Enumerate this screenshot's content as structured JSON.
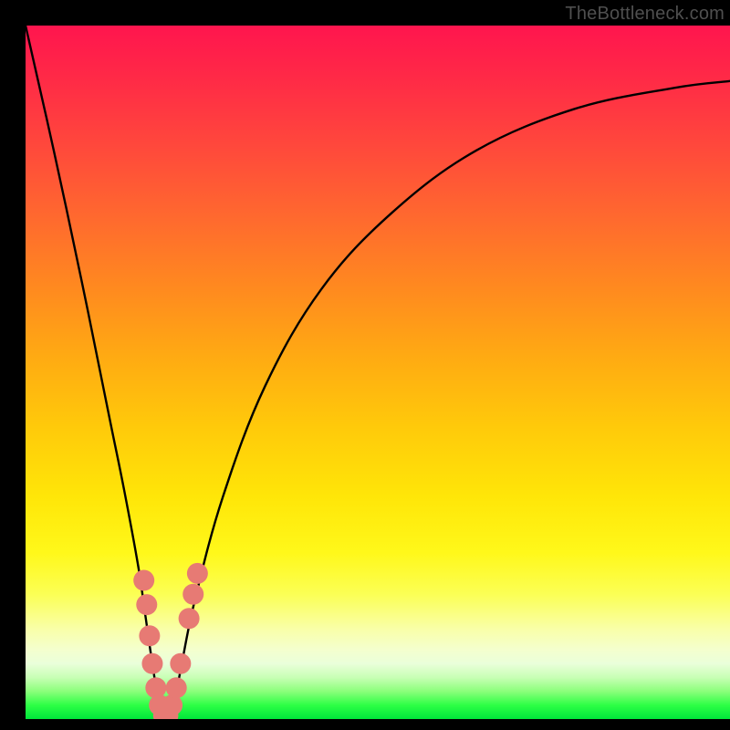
{
  "watermark": "TheBottleneck.com",
  "chart_data": {
    "type": "line",
    "title": "",
    "xlabel": "",
    "ylabel": "",
    "xlim": [
      0,
      100
    ],
    "ylim": [
      0,
      100
    ],
    "series": [
      {
        "name": "bottleneck-curve",
        "x": [
          0,
          4,
          8,
          12,
          14,
          16,
          17,
          18,
          19,
          20,
          21,
          22,
          24,
          28,
          34,
          42,
          52,
          64,
          78,
          92,
          100
        ],
        "y": [
          100,
          82,
          63,
          43,
          33,
          22,
          15,
          8,
          2,
          0,
          2,
          7,
          17,
          32,
          48,
          62,
          73,
          82,
          88,
          91,
          92
        ]
      }
    ],
    "markers": {
      "name": "highlight-dots",
      "color": "#e77a74",
      "points": [
        {
          "x": 16.8,
          "y": 20.0
        },
        {
          "x": 17.2,
          "y": 16.5
        },
        {
          "x": 17.6,
          "y": 12.0
        },
        {
          "x": 18.0,
          "y": 8.0
        },
        {
          "x": 18.5,
          "y": 4.5
        },
        {
          "x": 19.0,
          "y": 2.0
        },
        {
          "x": 19.6,
          "y": 0.5
        },
        {
          "x": 20.2,
          "y": 0.5
        },
        {
          "x": 20.8,
          "y": 2.0
        },
        {
          "x": 21.4,
          "y": 4.5
        },
        {
          "x": 22.0,
          "y": 8.0
        },
        {
          "x": 23.2,
          "y": 14.5
        },
        {
          "x": 23.8,
          "y": 18.0
        },
        {
          "x": 24.4,
          "y": 21.0
        }
      ]
    },
    "background_gradient": {
      "top": "#ff154e",
      "mid": "#ffe608",
      "bottom": "#00e63b"
    }
  }
}
